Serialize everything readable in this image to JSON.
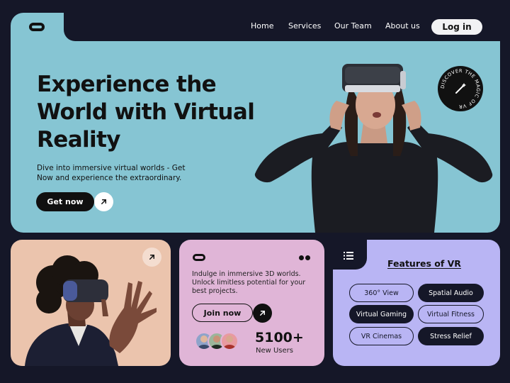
{
  "nav": {
    "links": [
      "Home",
      "Services",
      "Our Team",
      "About us"
    ],
    "login_label": "Log in"
  },
  "hero": {
    "title": "Experience the World with Virtual Reality",
    "subtitle": "Dive into immersive virtual worlds - Get Now and experience the extraordinary.",
    "cta_label": "Get now",
    "badge_text": "DISCOVER THE MAGIC OF VR"
  },
  "card2": {
    "description": "Indulge in immersive 3D worlds. Unlock limitless potential for your best projects.",
    "join_label": "Join now",
    "users_count": "5100+",
    "users_label": "New Users"
  },
  "card3": {
    "title": "Features of VR",
    "features": [
      "360° View",
      "Spatial Audio",
      "Virtual Gaming",
      "Virtual Fitness",
      "VR Cinemas",
      "Stress Relief"
    ]
  },
  "colors": {
    "background": "#151728",
    "hero": "#86c5d3",
    "card1": "#ebc4ad",
    "card2": "#e0b5d7",
    "card3": "#b9b5f4"
  }
}
